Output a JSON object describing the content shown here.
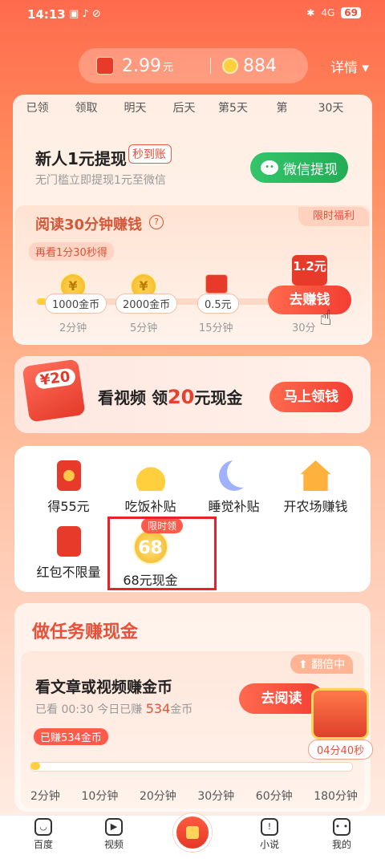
{
  "status_bar": {
    "time": "14:13",
    "battery": "69",
    "signal": "4G"
  },
  "balance": {
    "money": "2.99",
    "money_unit": "元",
    "coins": "884",
    "detail_label": "详情 ▾"
  },
  "sign_days": [
    "已领",
    "领取",
    "明天",
    "后天",
    "第5天",
    "第",
    "30天"
  ],
  "newbie": {
    "title": "新人1元提现",
    "badge": "秒到账",
    "subtitle": "无门槛立即提现1元至微信",
    "button": "微信提现"
  },
  "reading": {
    "title": "阅读30分钟赚钱",
    "limited": "限时福利",
    "tip": "再看1分30秒得",
    "milestones": [
      {
        "reward": "1000金币",
        "time": "2分钟"
      },
      {
        "reward": "2000金币",
        "time": "5分钟"
      },
      {
        "reward": "0.5元",
        "time": "15分钟"
      },
      {
        "reward": "1.2元",
        "time": "30分"
      }
    ],
    "go_button": "去赚钱",
    "progress_fraction": 0.03
  },
  "video_banner": {
    "amount": "¥20",
    "text_pre": "看视频 领",
    "text_amount": "20",
    "text_post": "元现金",
    "button": "马上领钱"
  },
  "grid": [
    {
      "label": "得55元",
      "icon": "red-envelope-icon"
    },
    {
      "label": "吃饭补贴",
      "icon": "bowl-icon"
    },
    {
      "label": "睡觉补贴",
      "icon": "moon-icon"
    },
    {
      "label": "开农场赚钱",
      "icon": "farm-house-icon"
    },
    {
      "label": "红包不限量",
      "icon": "red-cards-icon"
    },
    {
      "label": "68元现金",
      "icon": "coin-68-icon",
      "coin_text": "68",
      "tag": "限时领"
    }
  ],
  "task": {
    "header": "做任务赚现金",
    "double_tag": "翻倍中",
    "title": "看文章或视频赚金币",
    "watched_label": "已看",
    "watched": "00:30",
    "earned_label": "今日已赚",
    "earned": "534",
    "earned_unit": "金币",
    "earned_tag": "已赚534金币",
    "button": "去阅读",
    "timer": "04分40秒",
    "steps": [
      "2分钟",
      "10分钟",
      "20分钟",
      "30分钟",
      "60分钟",
      "180分钟"
    ],
    "progress_fraction": 0.03
  },
  "nav": [
    {
      "label": "百度"
    },
    {
      "label": "视频"
    },
    {
      "label": ""
    },
    {
      "label": "小说"
    },
    {
      "label": "我的"
    }
  ]
}
